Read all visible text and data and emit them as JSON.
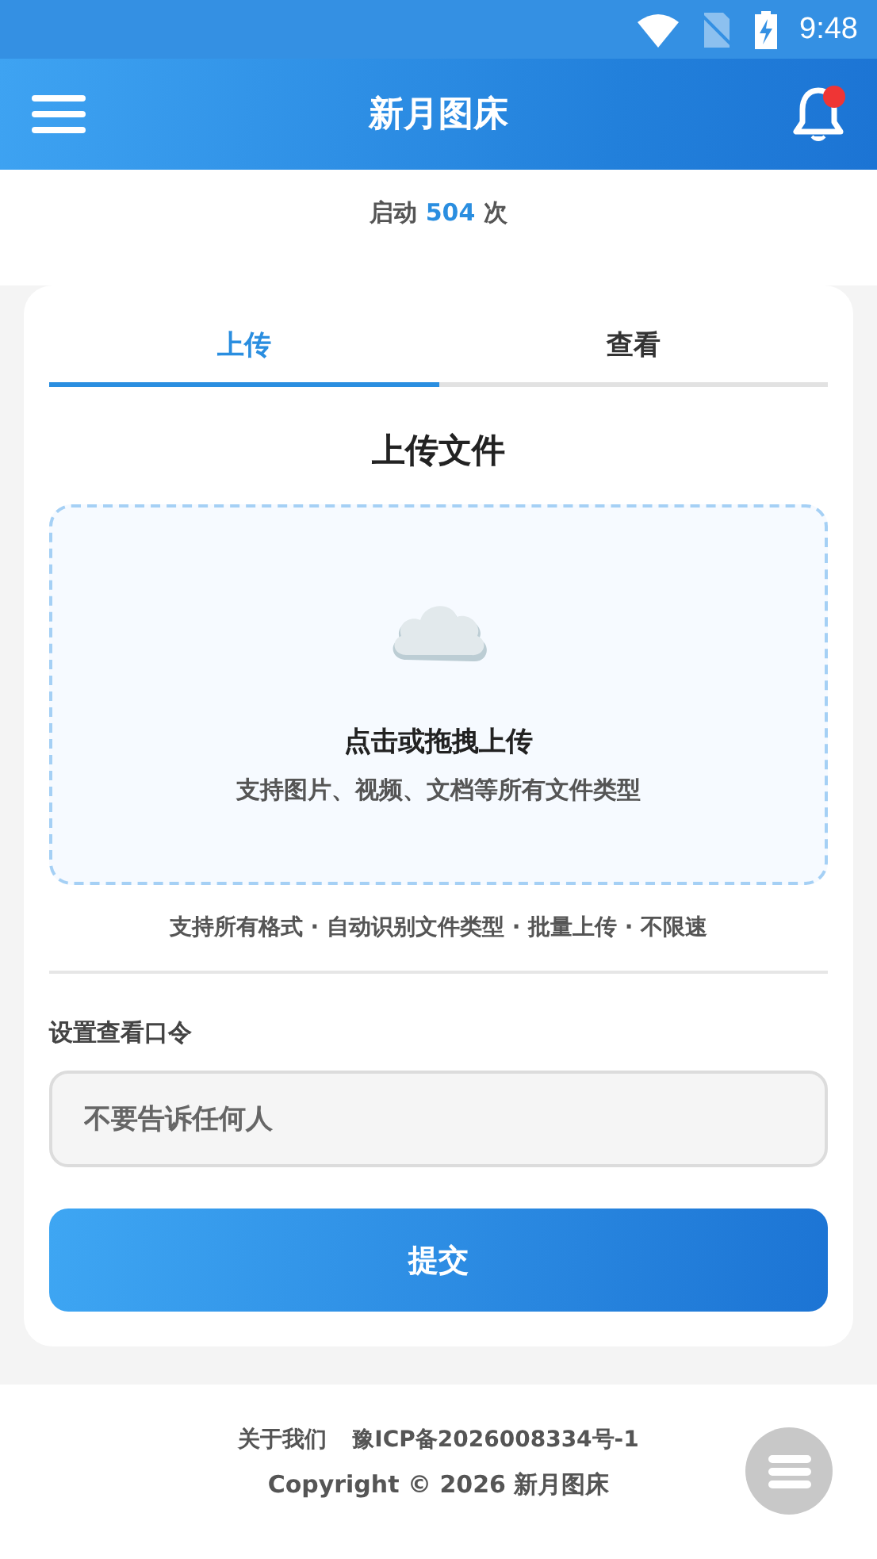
{
  "status_bar": {
    "time": "9:48"
  },
  "app_bar": {
    "title": "新月图床",
    "has_notification": true
  },
  "launch_count": {
    "prefix": "启动",
    "count": "504",
    "suffix": "次"
  },
  "tabs": [
    {
      "label": "上传",
      "selected": true
    },
    {
      "label": "查看",
      "selected": false
    }
  ],
  "upload": {
    "title": "上传文件",
    "drop_title": "点击或拖拽上传",
    "drop_hint": "支持图片、视频、文档等所有文件类型",
    "features": "支持所有格式 · 自动识别文件类型 · 批量上传 · 不限速"
  },
  "password": {
    "label": "设置查看口令",
    "placeholder": "不要告诉任何人"
  },
  "submit": "提交",
  "footer": {
    "links": [
      "关于我们",
      "豫ICP备2026008334号-1"
    ],
    "copyright": "Copyright © 2026 新月图床"
  }
}
